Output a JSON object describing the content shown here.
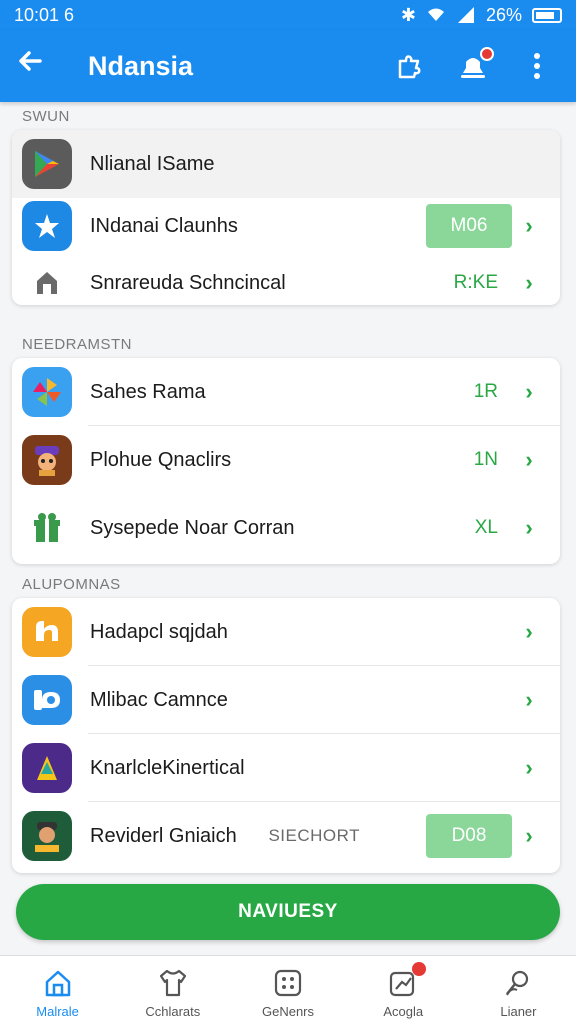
{
  "status": {
    "time": "10:01 6",
    "battery": "26%"
  },
  "header": {
    "title": "Ndansia"
  },
  "sections": [
    {
      "label": "SWUN"
    },
    {
      "label": "NEEDRAMSTN"
    },
    {
      "label": "ALUPOMNAS"
    }
  ],
  "rows": [
    {
      "label": "Nlianal ISame",
      "value": "",
      "pill": "",
      "extra": "",
      "icon": "play-store-icon"
    },
    {
      "label": "INdanai Claunhs",
      "value": "",
      "pill": "M06",
      "extra": "",
      "icon": "star-app-icon"
    },
    {
      "label": "Snrareuda Schncincal",
      "value": "R:KE",
      "pill": "",
      "extra": "",
      "icon": "home-icon"
    },
    {
      "label": "Sahes Rama",
      "value": "1R",
      "pill": "",
      "extra": "",
      "icon": "pinwheel-app-icon"
    },
    {
      "label": "Plohue Qnaclirs",
      "value": "1N",
      "pill": "",
      "extra": "",
      "icon": "pirate-game-icon"
    },
    {
      "label": "Sysepede Noar Corran",
      "value": "XL",
      "pill": "",
      "extra": "",
      "icon": "gift-icon"
    },
    {
      "label": "Hadapcl sqjdah",
      "value": "",
      "pill": "",
      "extra": "",
      "icon": "orange-app-icon"
    },
    {
      "label": "Mlibac Camnce",
      "value": "",
      "pill": "",
      "extra": "",
      "icon": "blue-app-icon"
    },
    {
      "label": "KnarlcleKinertical",
      "value": "",
      "pill": "",
      "extra": "",
      "icon": "purple-game-icon"
    },
    {
      "label": "Reviderl Gniaich",
      "value": "",
      "pill": "D08",
      "extra": "SIECHORT",
      "icon": "character-game-icon"
    }
  ],
  "cta": {
    "label": "NAVIUESY"
  },
  "nav": [
    {
      "label": "Malrale",
      "icon": "home-icon"
    },
    {
      "label": "Cchlarats",
      "icon": "shirt-icon"
    },
    {
      "label": "GeNenrs",
      "icon": "grid-icon"
    },
    {
      "label": "Acogla",
      "icon": "chart-icon"
    },
    {
      "label": "Lianer",
      "icon": "search-person-icon"
    }
  ],
  "colors": {
    "primary": "#1a8cf0",
    "accent": "#27a844"
  }
}
